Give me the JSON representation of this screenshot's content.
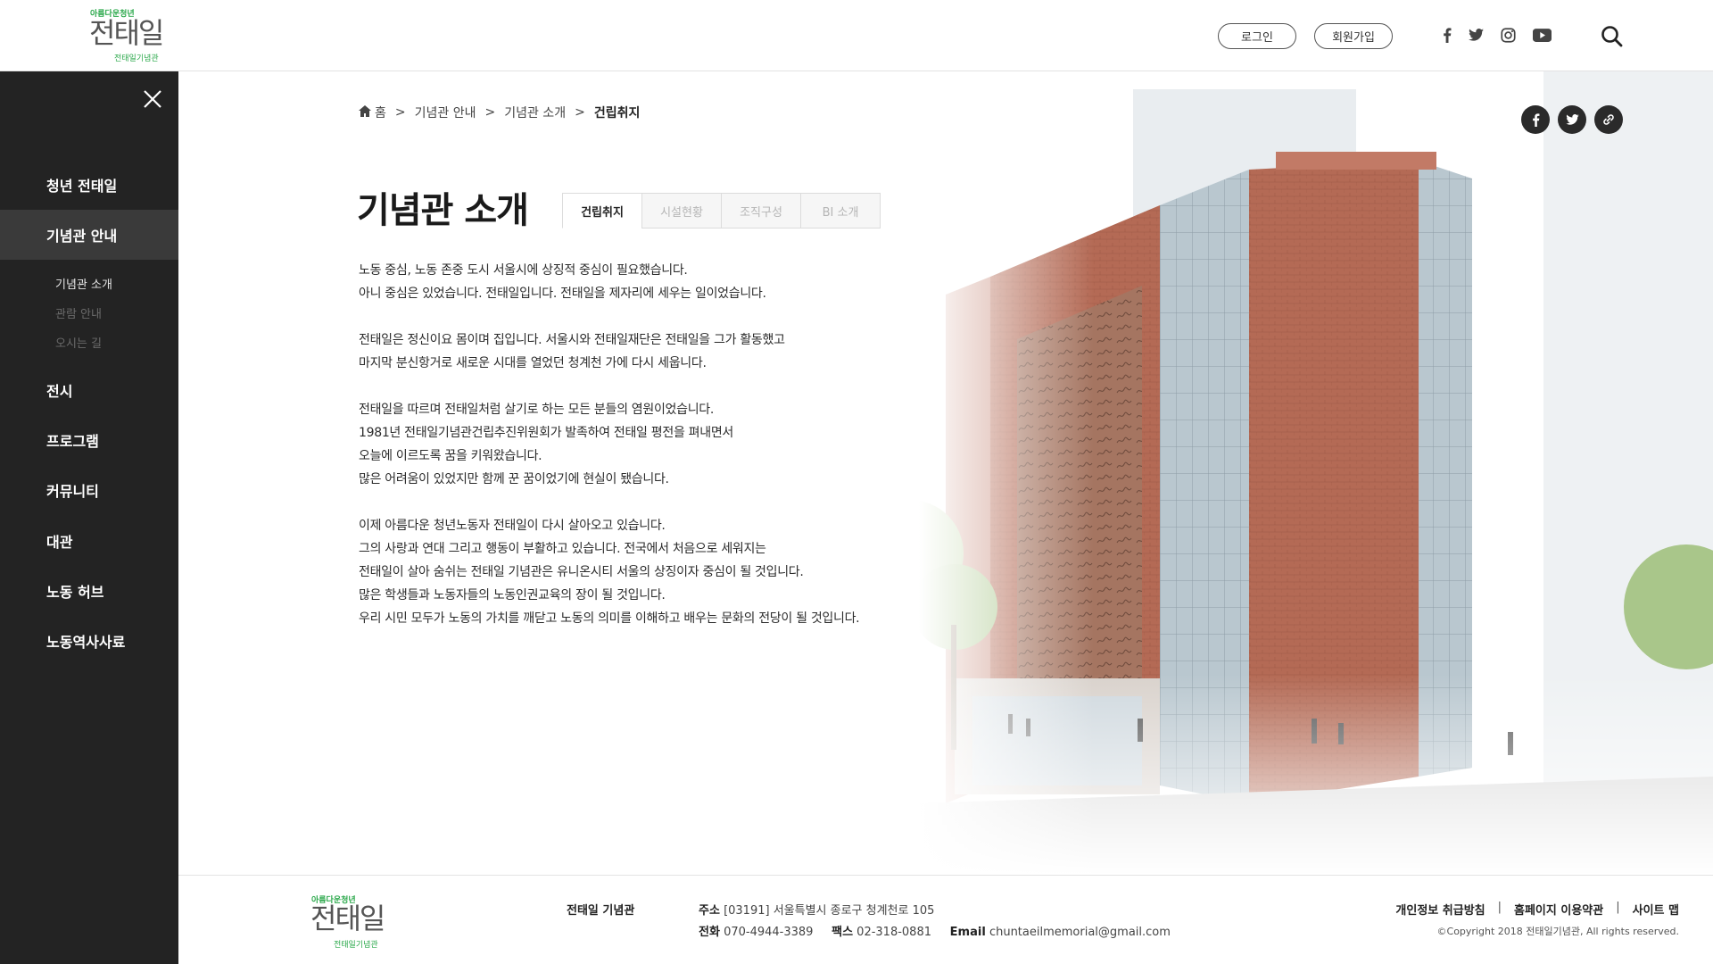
{
  "header": {
    "logo": {
      "small": "아름다운청년",
      "big": "전태일",
      "sub": "전태일기념관"
    },
    "login_label": "로그인",
    "signup_label": "회원가입",
    "social_icons": [
      "facebook-icon",
      "twitter-icon",
      "instagram-icon",
      "youtube-icon"
    ],
    "search_icon": "search-icon"
  },
  "sidebar": {
    "items": [
      {
        "label": "청년 전태일"
      },
      {
        "label": "기념관 안내"
      },
      {
        "label": "전시"
      },
      {
        "label": "프로그램"
      },
      {
        "label": "커뮤니티"
      },
      {
        "label": "대관"
      },
      {
        "label": "노동 허브"
      },
      {
        "label": "노동역사사료"
      }
    ],
    "subitems": [
      {
        "label": "기념관 소개"
      },
      {
        "label": "관람 안내"
      },
      {
        "label": "오시는 길"
      }
    ]
  },
  "breadcrumb": {
    "items": [
      "홈",
      "기념관 안내",
      "기념관 소개",
      "건립취지"
    ],
    "separator": ">"
  },
  "page": {
    "title": "기념관 소개",
    "tabs": [
      "건립취지",
      "시설현황",
      "조직구성",
      "BI 소개"
    ],
    "active_tab": "건립취지"
  },
  "content": {
    "paragraphs": [
      [
        "노동 중심, 노동 존중 도시 서울시에 상징적 중심이 필요했습니다.",
        "아니 중심은 있었습니다. 전태일입니다. 전태일을 제자리에 세우는 일이었습니다."
      ],
      [
        "전태일은 정신이요 몸이며 집입니다. 서울시와 전태일재단은 전태일을 그가 활동했고",
        "마지막 분신항거로 새로운 시대를 열었던 청계천 가에 다시 세웁니다."
      ],
      [
        "전태일을 따르며 전태일처럼 살기로 하는 모든 분들의 염원이었습니다.",
        "1981년 전태일기념관건립추진위원회가 발족하여 전태일 평전을 펴내면서",
        "오늘에 이르도록 꿈을 키워왔습니다.",
        "많은 어려움이 있었지만 함께 꾼 꿈이었기에 현실이 됐습니다."
      ],
      [
        "이제 아름다운 청년노동자 전태일이 다시 살아오고 있습니다.",
        "그의 사랑과 연대 그리고 행동이 부활하고 있습니다. 전국에서 처음으로 세워지는",
        "전태일이 살아 숨쉬는 전태일 기념관은 유니온시티 서울의 상징이자 중심이 될 것입니다.",
        "많은 학생들과 노동자들의 노동인권교육의 장이 될 것입니다.",
        "우리 시민 모두가 노동의 가치를 깨닫고 노동의 의미를 이해하고 배우는 문화의 전당이 될 것입니다."
      ]
    ]
  },
  "share_icons": [
    "facebook-icon",
    "twitter-icon",
    "link-icon"
  ],
  "footer": {
    "logo": {
      "small": "아름다운청년",
      "big": "전태일",
      "sub": "전태일기념관"
    },
    "name": "전태일 기념관",
    "address_label": "주소",
    "address": "[03191] 서울특별시 종로구 청계천로 105",
    "phone_label": "전화",
    "phone": "070-4944-3389",
    "fax_label": "팩스",
    "fax": "02-318-0881",
    "email_label": "Email",
    "email": "chuntaeilmemorial@gmail.com",
    "links": [
      "개인정보 취급방침",
      "홈페이지 이용약관",
      "사이트 맵"
    ],
    "copyright": "©Copyright 2018 전태일기념관, All rights reserved."
  },
  "colors": {
    "sidebar_bg": "#232323",
    "sidebar_active": "#3a3a3a",
    "logo_green": "#2aa84a",
    "brick": "#b46a55"
  }
}
